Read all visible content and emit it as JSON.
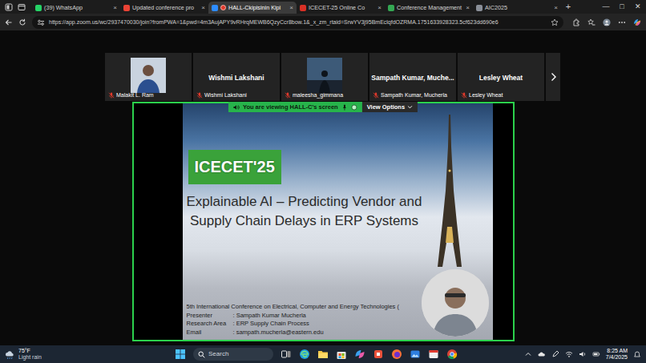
{
  "browser": {
    "tabs": [
      {
        "label": "(39) WhatsApp",
        "selected": false,
        "recording": false,
        "color": "#25d366"
      },
      {
        "label": "Updated conference pro",
        "selected": false,
        "recording": false,
        "color": "#ea4335"
      },
      {
        "label": "HALL-Ckipisinin Kipi",
        "selected": true,
        "recording": true,
        "color": "#2d8cff"
      },
      {
        "label": "ICECET-25 Online Co",
        "selected": false,
        "recording": false,
        "color": "#d93025"
      },
      {
        "label": "Conference Management",
        "selected": false,
        "recording": false,
        "color": "#34a853"
      },
      {
        "label": "AIC2025",
        "selected": false,
        "recording": false,
        "color": "#8a8f98"
      }
    ],
    "tab_close": "×",
    "new_tab": "+",
    "window_controls": [
      "—",
      "□",
      "✕"
    ],
    "url": "https://app.zoom.us/wc/2937470030/join?fromPWA=1&pwd=4m3AujAPY9vRHrqMEWB6QzyCcr8bow.1&_x_zm_rtaid=SrwYV3j95BmEclqfdOZRMA.1751633928323.5cf623dd690e6"
  },
  "meeting": {
    "participants": [
      {
        "kind": "video",
        "label": "Malakit L. Ram",
        "muted": true
      },
      {
        "kind": "name",
        "title": "Wishmi Lakshani",
        "label": "Wishmi Lakshani",
        "muted": true
      },
      {
        "kind": "video",
        "label": "maleesha_gimmana",
        "muted": true
      },
      {
        "kind": "name",
        "title": "Sampath Kumar, Muche...",
        "label": "Sampath Kumar, Mucherla",
        "muted": true
      },
      {
        "kind": "name",
        "title": "Lesley Wheat",
        "label": "Lesley Wheat",
        "muted": true
      }
    ],
    "banner": {
      "text": "You are viewing  HALL-C's screen",
      "button": "View Options"
    }
  },
  "slide": {
    "badge": "ICECET'25",
    "title": "Explainable AI – Predicting Vendor and Supply Chain Delays in ERP Systems",
    "conference": "5th International Conference on Electrical, Computer and Energy Technologies (",
    "rows": [
      {
        "label": "Presenter",
        "value": ": Sampath Kumar Mucherla"
      },
      {
        "label": "Research Area",
        "value": ": ERP Supply Chain Process"
      },
      {
        "label": "Email",
        "value": ": sampath.mucherla@eastern.edu"
      }
    ]
  },
  "taskbar": {
    "weather_temp": "75°F",
    "weather_desc": "Light rain",
    "search_placeholder": "Search",
    "time": "8:25 AM",
    "date": "7/4/2025"
  }
}
